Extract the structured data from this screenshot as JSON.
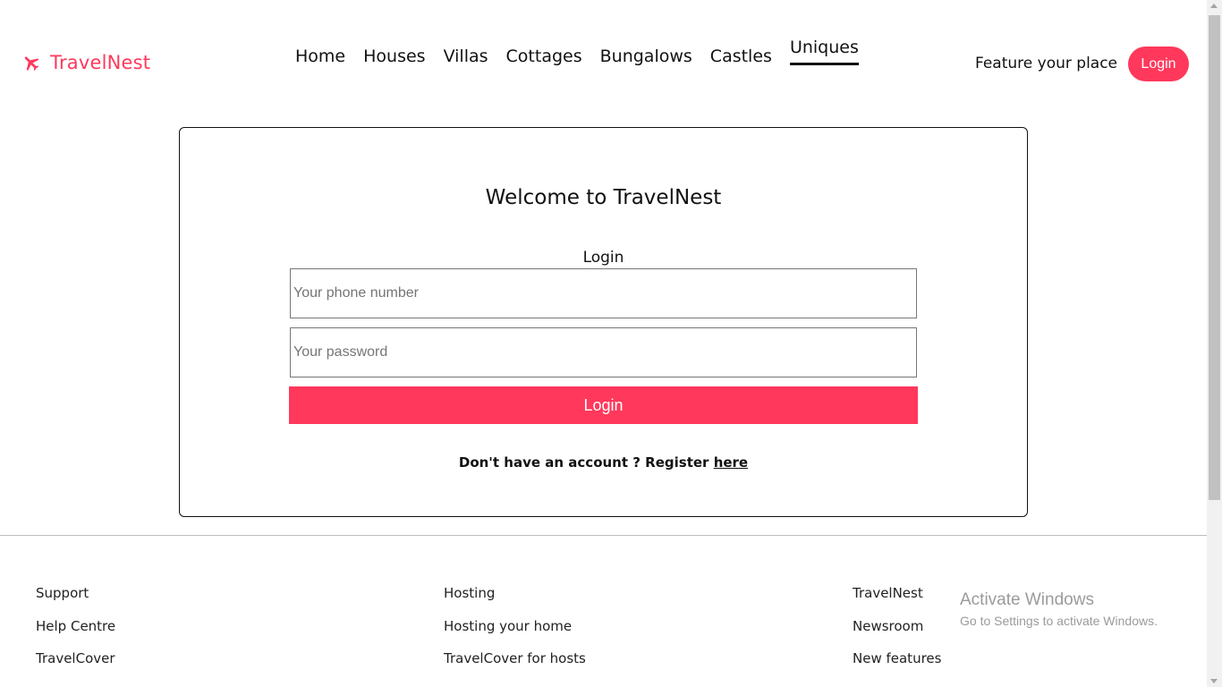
{
  "brand": {
    "name": "TravelNest",
    "icon": "airplane-icon",
    "color": "#ff385c"
  },
  "nav": {
    "items": [
      "Home",
      "Houses",
      "Villas",
      "Cottages",
      "Bungalows",
      "Castles",
      "Uniques"
    ],
    "active": "Uniques"
  },
  "header": {
    "feature_link": "Feature your place",
    "login_button": "Login"
  },
  "card": {
    "title": "Welcome to TravelNest",
    "form_title": "Login",
    "phone_placeholder": "Your phone number",
    "password_placeholder": "Your password",
    "submit_label": "Login",
    "register_text": "Don't have an account ? Register",
    "register_link": "here"
  },
  "footer": {
    "columns": [
      [
        "Support",
        "Help Centre",
        "TravelCover"
      ],
      [
        "Hosting",
        "Hosting your home",
        "TravelCover for hosts"
      ],
      [
        "TravelNest",
        "Newsroom",
        "New features"
      ]
    ]
  },
  "watermark": {
    "title": "Activate Windows",
    "subtitle": "Go to Settings to activate Windows."
  },
  "colors": {
    "accent": "#ff385c",
    "text": "#111111",
    "divider": "#bdbdbd"
  }
}
